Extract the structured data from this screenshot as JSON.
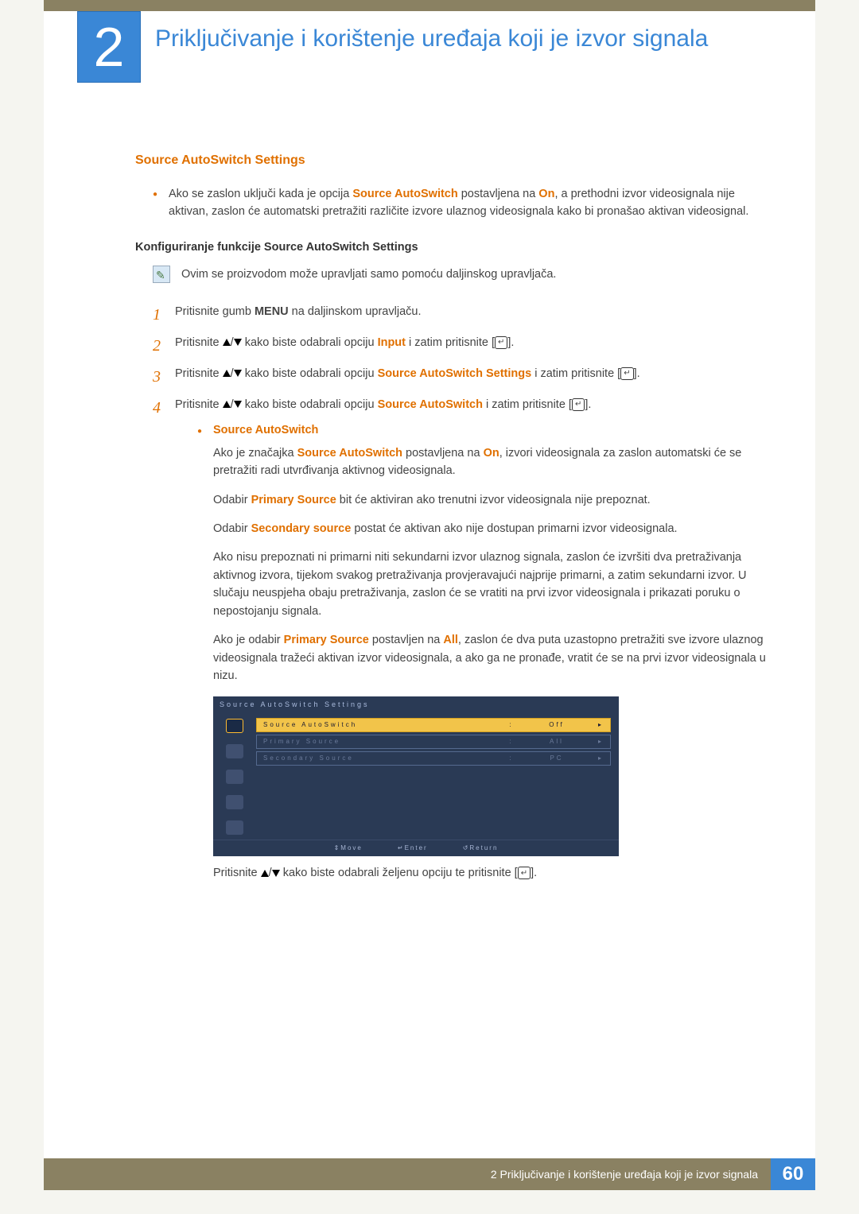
{
  "chapter": {
    "number": "2",
    "title": "Priključivanje i korištenje uređaja koji je izvor signala"
  },
  "section": {
    "heading": "Source AutoSwitch Settings",
    "intro_bullet_pre": "Ako se zaslon uključi kada je opcija ",
    "intro_bullet_opt": "Source AutoSwitch",
    "intro_bullet_mid": " postavljena na ",
    "intro_bullet_on": "On",
    "intro_bullet_post": ", a prethodni izvor videosignala nije aktivan, zaslon će automatski pretražiti različite izvore ulaznog videosignala kako bi pronašao aktivan videosignal.",
    "subhead": "Konfiguriranje funkcije Source AutoSwitch Settings",
    "note": "Ovim se proizvodom može upravljati samo pomoću daljinskog upravljača."
  },
  "steps": {
    "s1_pre": "Pritisnite gumb ",
    "s1_menu": "MENU",
    "s1_post": " na daljinskom upravljaču.",
    "s2_pre": "Pritisnite ",
    "s2_mid": " kako biste odabrali opciju ",
    "s2_opt": "Input",
    "s2_post": " i zatim pritisnite [",
    "s3_pre": "Pritisnite ",
    "s3_mid": " kako biste odabrali opciju ",
    "s3_opt": "Source AutoSwitch Settings",
    "s3_post": " i zatim pritisnite [",
    "end_bracket": "].",
    "s4_pre": "Pritisnite ",
    "s4_mid": " kako biste odabrali opciju ",
    "s4_opt": "Source AutoSwitch",
    "s4_post": " i zatim pritisnite ["
  },
  "sub": {
    "title": "Source AutoSwitch",
    "p1_pre": "Ako je značajka ",
    "p1_opt": "Source AutoSwitch",
    "p1_mid": " postavljena na ",
    "p1_on": "On",
    "p1_post": ", izvori videosignala za zaslon automatski će se pretražiti radi utvrđivanja aktivnog videosignala.",
    "p2_pre": "Odabir ",
    "p2_opt": "Primary Source",
    "p2_post": " bit će aktiviran ako trenutni izvor videosignala nije prepoznat.",
    "p3_pre": "Odabir ",
    "p3_opt": "Secondary source",
    "p3_post": " postat će aktivan ako nije dostupan primarni izvor videosignala.",
    "p4": "Ako nisu prepoznati ni primarni niti sekundarni izvor ulaznog signala, zaslon će izvršiti dva pretraživanja aktivnog izvora, tijekom svakog pretraživanja provjeravajući najprije primarni, a zatim sekundarni izvor. U slučaju neuspjeha obaju pretraživanja, zaslon će se vratiti na prvi izvor videosignala i prikazati poruku o nepostojanju signala.",
    "p5_pre": "Ako je odabir ",
    "p5_opt": "Primary Source",
    "p5_mid": " postavljen na ",
    "p5_all": "All",
    "p5_post": ", zaslon će dva puta uzastopno pretražiti sve izvore ulaznog videosignala tražeći aktivan izvor videosignala, a ako ga ne pronađe, vratit će se na prvi izvor videosignala u nizu."
  },
  "osd": {
    "title": "Source AutoSwitch Settings",
    "rows": [
      {
        "label": "Source AutoSwitch",
        "value": "Off",
        "sel": true
      },
      {
        "label": "Primary Source",
        "value": "All",
        "dim": true
      },
      {
        "label": "Secondary Source",
        "value": "PC",
        "dim": true
      }
    ],
    "foot": {
      "move": "Move",
      "enter": "Enter",
      "return": "Return"
    }
  },
  "after_osd_pre": "Pritisnite ",
  "after_osd_mid": " kako biste odabrali željenu opciju te pritisnite [",
  "footer": {
    "text": "2 Priključivanje i korištenje uređaja koji je izvor signala",
    "page": "60"
  }
}
